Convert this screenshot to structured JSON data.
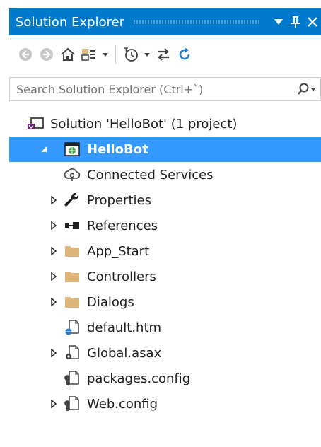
{
  "window": {
    "title": "Solution Explorer"
  },
  "search": {
    "placeholder": "Search Solution Explorer (Ctrl+`)"
  },
  "tree": {
    "solution_label": "Solution 'HelloBot' (1 project)",
    "project_label": "HelloBot",
    "items": [
      {
        "label": "Connected Services",
        "icon": "connected-services-icon",
        "expandable": false
      },
      {
        "label": "Properties",
        "icon": "wrench-icon",
        "expandable": true
      },
      {
        "label": "References",
        "icon": "references-icon",
        "expandable": true
      },
      {
        "label": "App_Start",
        "icon": "folder-icon",
        "expandable": true
      },
      {
        "label": "Controllers",
        "icon": "folder-icon",
        "expandable": true
      },
      {
        "label": "Dialogs",
        "icon": "folder-icon",
        "expandable": true
      },
      {
        "label": "default.htm",
        "icon": "html-file-icon",
        "expandable": false
      },
      {
        "label": "Global.asax",
        "icon": "asax-file-icon",
        "expandable": true
      },
      {
        "label": "packages.config",
        "icon": "config-file-icon",
        "expandable": false
      },
      {
        "label": "Web.config",
        "icon": "config-file-icon",
        "expandable": true
      }
    ]
  },
  "colors": {
    "accent": "#007acc",
    "selection": "#3399ff",
    "folder": "#dcb67a"
  }
}
